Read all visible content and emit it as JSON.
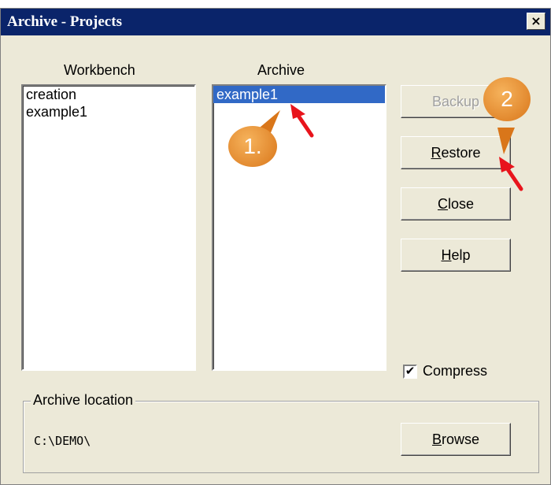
{
  "window": {
    "title": "Archive - Projects",
    "close_glyph": "×"
  },
  "workbench": {
    "label": "Workbench",
    "items": [
      "creation",
      "example1"
    ]
  },
  "archive": {
    "label": "Archive",
    "items": [
      "example1"
    ],
    "selected": "example1"
  },
  "buttons": {
    "backup": "Backup",
    "restore_first": "R",
    "restore_rest": "estore",
    "close_first": "C",
    "close_rest": "lose",
    "help_first": "H",
    "help_rest": "elp",
    "browse_first": "B",
    "browse_rest": "rowse"
  },
  "compress": {
    "label": "Compress",
    "checked": true,
    "check_glyph": "✔"
  },
  "location": {
    "legend": "Archive location",
    "path": "C:\\DEMO\\"
  },
  "annotations": {
    "step1": "1.",
    "step2": "2",
    "arrow_color": "#e8141c",
    "badge_color": "#e8892b"
  }
}
